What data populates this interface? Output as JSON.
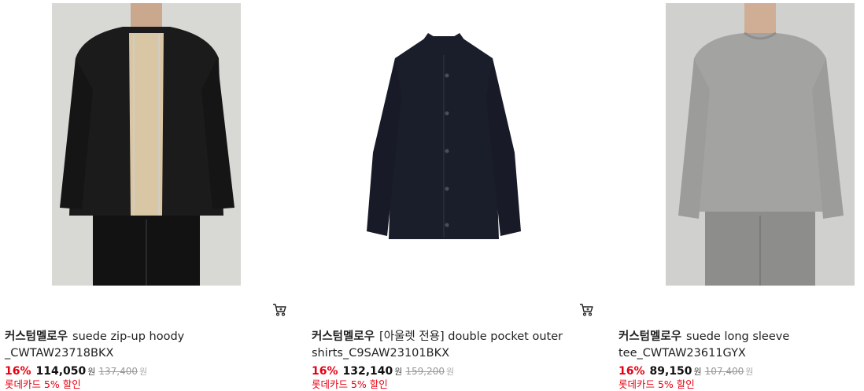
{
  "products": [
    {
      "brand": "커스텀멜로우",
      "name": "suede zip-up hoody _CWTAW23718BKX",
      "discount": "16%",
      "price": "114,050",
      "price_unit": "원",
      "original_price": "137,400",
      "original_unit": "원",
      "card_promo": "롯데카드 5% 할인",
      "image_icon": "hoody-photo",
      "has_cart": true
    },
    {
      "brand": "커스텀멜로우",
      "name": "[아울렛 전용] double pocket outer shirts_C9SAW23101BKX",
      "discount": "16%",
      "price": "132,140",
      "price_unit": "원",
      "original_price": "159,200",
      "original_unit": "원",
      "card_promo": "롯데카드 5% 할인",
      "image_icon": "shirt-photo",
      "has_cart": true
    },
    {
      "brand": "커스텀멜로우",
      "name": "suede long sleeve tee_CWTAW23611GYX",
      "discount": "16%",
      "price": "89,150",
      "price_unit": "원",
      "original_price": "107,400",
      "original_unit": "원",
      "card_promo": "롯데카드 5% 할인",
      "image_icon": "tee-photo",
      "has_cart": false
    }
  ],
  "colors": {
    "discount": "#e60012",
    "promo": "#e60012",
    "original_price": "#999999"
  },
  "icons": {
    "cart": "cart-icon"
  }
}
